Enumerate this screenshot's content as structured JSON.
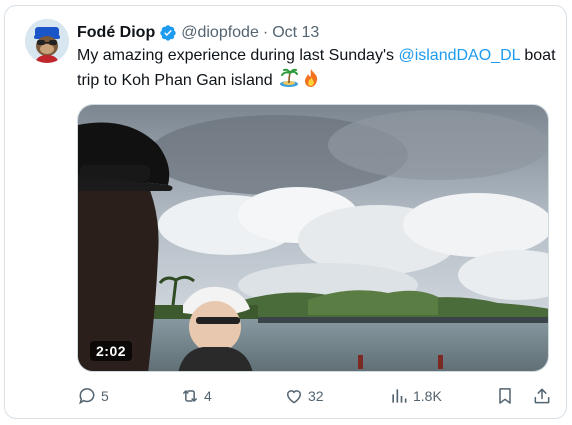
{
  "tweet": {
    "author_name": "Fodé Diop",
    "handle": "@diopfode",
    "separator": "·",
    "date": "Oct 13",
    "text_part1": "My amazing experience during last Sunday's ",
    "mention": "@islandDAO_DL",
    "text_part2": " boat trip to Koh Phan Gan island",
    "emojis": [
      "desert-island-emoji",
      "fire-emoji"
    ],
    "verified_color": "#1d9bf0"
  },
  "media": {
    "type": "video",
    "duration": "2:02"
  },
  "actions": {
    "reply_count": "5",
    "retweet_count": "4",
    "like_count": "32",
    "views_count": "1.8K"
  },
  "colors": {
    "accent": "#1d9bf0",
    "muted": "#536471",
    "text": "#0f1419"
  }
}
